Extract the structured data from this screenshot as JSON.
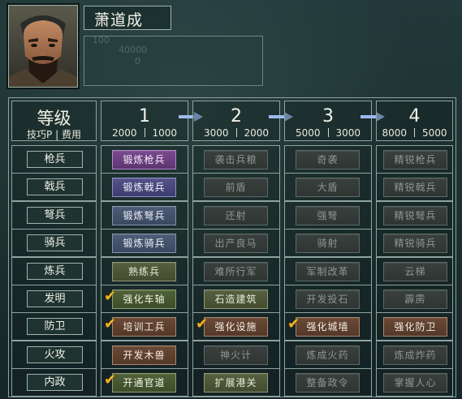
{
  "officer": {
    "name": "萧道成",
    "ghost_lines": [
      "100",
      "40000",
      "0"
    ]
  },
  "table": {
    "header_title": "等级",
    "header_sub": "技巧P | 费用",
    "tiers": [
      {
        "level": "1",
        "tech_points": "2000",
        "cost": "1000"
      },
      {
        "level": "2",
        "tech_points": "3000",
        "cost": "2000"
      },
      {
        "level": "3",
        "tech_points": "5000",
        "cost": "3000"
      },
      {
        "level": "4",
        "tech_points": "8000",
        "cost": "5000"
      }
    ],
    "rows": [
      {
        "label": "枪兵",
        "cells": [
          {
            "text": "锻炼枪兵",
            "style": "purple",
            "checked": false
          },
          {
            "text": "袭击兵粮",
            "style": "grey",
            "checked": false
          },
          {
            "text": "奇袭",
            "style": "grey",
            "checked": false
          },
          {
            "text": "精锐枪兵",
            "style": "grey",
            "checked": false
          }
        ]
      },
      {
        "label": "戟兵",
        "cells": [
          {
            "text": "锻炼戟兵",
            "style": "indigo",
            "checked": false
          },
          {
            "text": "前盾",
            "style": "grey",
            "checked": false
          },
          {
            "text": "大盾",
            "style": "grey",
            "checked": false
          },
          {
            "text": "精锐戟兵",
            "style": "grey",
            "checked": false
          }
        ]
      },
      {
        "label": "弩兵",
        "cells": [
          {
            "text": "锻炼弩兵",
            "style": "slate",
            "checked": false
          },
          {
            "text": "还射",
            "style": "grey",
            "checked": false
          },
          {
            "text": "强弩",
            "style": "grey",
            "checked": false
          },
          {
            "text": "精锐弩兵",
            "style": "grey",
            "checked": false
          }
        ]
      },
      {
        "label": "骑兵",
        "cells": [
          {
            "text": "锻炼骑兵",
            "style": "slate",
            "checked": false
          },
          {
            "text": "出产良马",
            "style": "grey",
            "checked": false
          },
          {
            "text": "骑射",
            "style": "grey",
            "checked": false
          },
          {
            "text": "精锐骑兵",
            "style": "grey",
            "checked": false
          }
        ]
      },
      {
        "label": "炼兵",
        "cells": [
          {
            "text": "熟练兵",
            "style": "olive",
            "checked": false
          },
          {
            "text": "难所行军",
            "style": "grey",
            "checked": false
          },
          {
            "text": "军制改革",
            "style": "grey",
            "checked": false
          },
          {
            "text": "云梯",
            "style": "grey",
            "checked": false
          }
        ]
      },
      {
        "label": "发明",
        "cells": [
          {
            "text": "强化车轴",
            "style": "green",
            "checked": true
          },
          {
            "text": "石造建筑",
            "style": "olive",
            "checked": false
          },
          {
            "text": "开发投石",
            "style": "grey",
            "checked": false
          },
          {
            "text": "霹雳",
            "style": "grey",
            "checked": false
          }
        ]
      },
      {
        "label": "防卫",
        "cells": [
          {
            "text": "培训工兵",
            "style": "brown",
            "checked": true
          },
          {
            "text": "强化设施",
            "style": "brown",
            "checked": true
          },
          {
            "text": "强化城墙",
            "style": "brown",
            "checked": true
          },
          {
            "text": "强化防卫",
            "style": "brown",
            "checked": false
          }
        ]
      },
      {
        "label": "火攻",
        "cells": [
          {
            "text": "开发木兽",
            "style": "brown",
            "checked": false
          },
          {
            "text": "神火计",
            "style": "grey",
            "checked": false
          },
          {
            "text": "炼成火药",
            "style": "grey",
            "checked": false
          },
          {
            "text": "炼成炸药",
            "style": "grey",
            "checked": false
          }
        ]
      },
      {
        "label": "内政",
        "cells": [
          {
            "text": "开通官道",
            "style": "green",
            "checked": true
          },
          {
            "text": "扩展港关",
            "style": "olive",
            "checked": false
          },
          {
            "text": "整备政令",
            "style": "grey",
            "checked": false
          },
          {
            "text": "掌握人心",
            "style": "grey",
            "checked": false
          }
        ]
      }
    ]
  },
  "colors": {
    "panel_bg": "#1c302e",
    "border": "#8fa39f",
    "arrow": "#9eb9ee",
    "checkmark": "#f2b21d"
  },
  "icons": {
    "arrow": "right-arrow-icon",
    "checked": "checkmark-icon"
  }
}
